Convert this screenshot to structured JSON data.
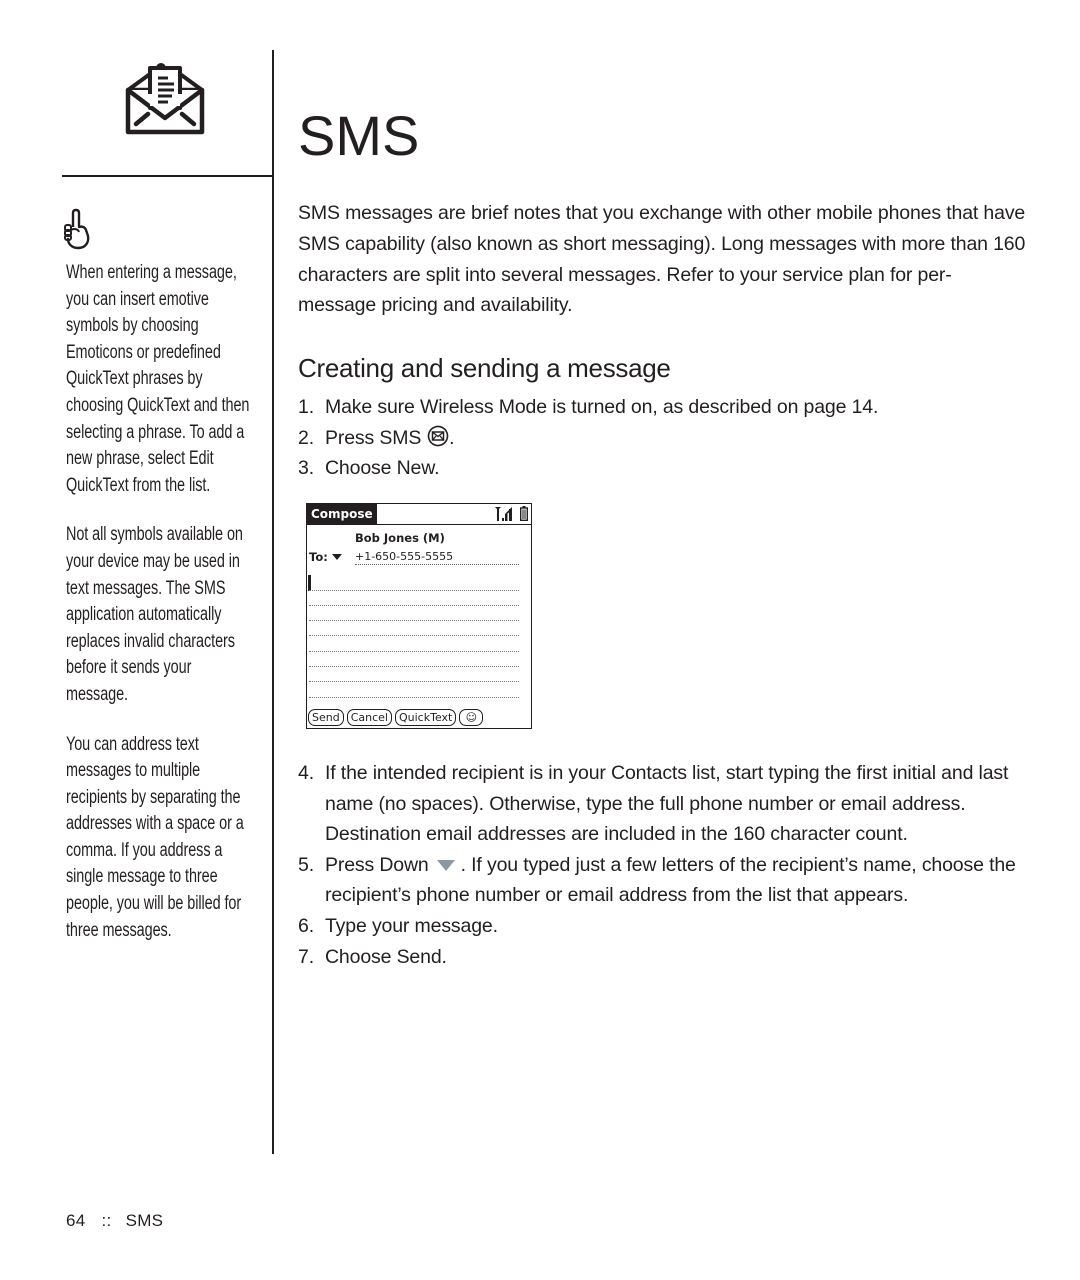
{
  "page": {
    "title": "SMS",
    "header_icon": "open-envelope-letter-icon",
    "tip_icon": "pointing-hand-icon"
  },
  "sidebar": {
    "notes": [
      "When entering a message, you can insert emotive symbols by choosing Emoticons or predefined QuickText phrases by choosing QuickText and then selecting a phrase. To add a new phrase, select Edit QuickText from the list.",
      "Not all symbols available on your device may be used in text messages. The SMS application automatically replaces invalid characters before it sends your message.",
      "You can address text messages to multiple recipients by separating the addresses with a space or a comma. If you address a single message to three people, you will be billed for three messages."
    ]
  },
  "main": {
    "intro": "SMS messages are brief notes that you exchange with other mobile phones that have SMS capability (also known as short messaging). Long messages with more than 160 characters are split into several messages. Refer to your service plan for per-message pricing and availability.",
    "section_heading": "Creating and sending a message",
    "steps_a": [
      {
        "num": "1.",
        "text": "Make sure Wireless Mode is turned on, as described on page 14."
      },
      {
        "num": "2.",
        "text": "Press SMS",
        "suffix": ".",
        "icon": "sms-key-icon"
      },
      {
        "num": "3.",
        "text": "Choose New."
      }
    ],
    "steps_b": [
      {
        "num": "4.",
        "text": "If the intended recipient is in your Contacts list, start typing the first initial and last name (no spaces). Otherwise, type the full phone number or email address. Destination email addresses are included in the 160 character count."
      },
      {
        "num": "5.",
        "text": "Press Down",
        "suffix": ". If you typed just a few letters of the recipient’s name, choose the recipient’s phone number or email address from the list that appears.",
        "icon": "down-arrow-key-icon"
      },
      {
        "num": "6.",
        "text": "Type your message."
      },
      {
        "num": "7.",
        "text": "Choose Send."
      }
    ]
  },
  "device_screen": {
    "title": "Compose",
    "contact_name": "Bob Jones (M)",
    "to_label": "To:",
    "to_number": "+1-650-555-5555",
    "message_text": "",
    "buttons": {
      "send": "Send",
      "cancel": "Cancel",
      "quicktext": "QuickText",
      "emoticon": "☺"
    },
    "status_icons": [
      "signal-strength-icon",
      "battery-icon"
    ]
  },
  "footer": {
    "page_number": "64",
    "separator": "::",
    "chapter": "SMS"
  },
  "colors": {
    "text": "#231f20",
    "down_key": "#8a9aa2"
  }
}
